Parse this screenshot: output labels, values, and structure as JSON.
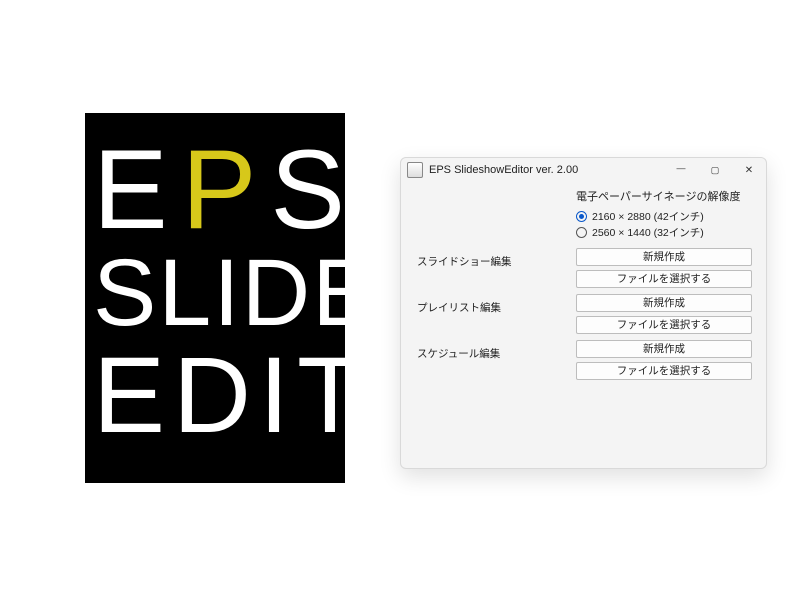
{
  "logo": {
    "line1_a": "E",
    "line1_b": "P",
    "line1_c": "S",
    "line2": "SLIDE",
    "line3": "EDIT"
  },
  "window": {
    "title": "EPS SlideshowEditor  ver. 2.00"
  },
  "resolution": {
    "heading": "電子ペーパーサイネージの解像度",
    "option1": "2160 × 2880 (42インチ)",
    "option2": "2560 × 1440 (32インチ)",
    "selected": "option1"
  },
  "sections": {
    "slideshow": {
      "label": "スライドショー編集",
      "new": "新規作成",
      "open": "ファイルを選択する"
    },
    "playlist": {
      "label": "プレイリスト編集",
      "new": "新規作成",
      "open": "ファイルを選択する"
    },
    "schedule": {
      "label": "スケジュール編集",
      "new": "新規作成",
      "open": "ファイルを選択する"
    }
  }
}
